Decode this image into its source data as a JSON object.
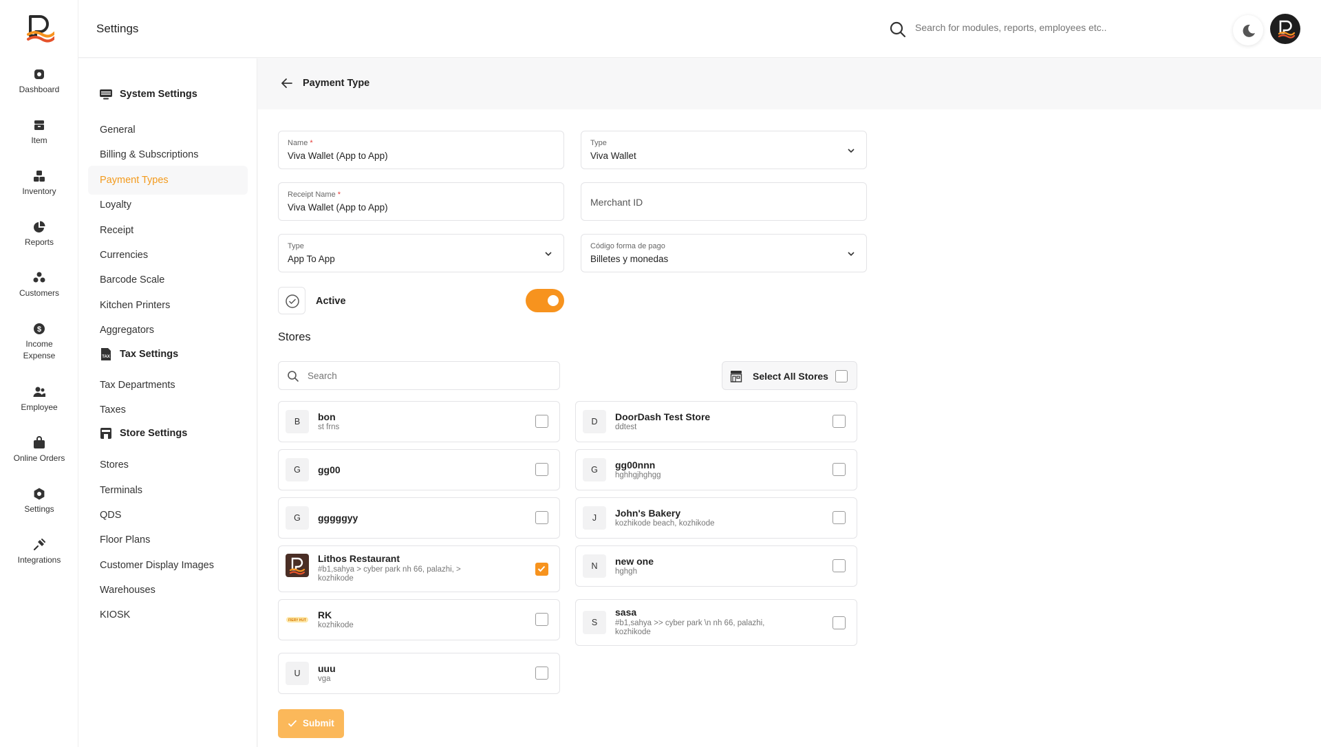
{
  "app": {
    "page_title": "Settings",
    "search_placeholder": "Search for modules, reports, employees etc.."
  },
  "rail": {
    "items": [
      {
        "label": "Dashboard",
        "icon": "dashboard-icon"
      },
      {
        "label": "Item",
        "icon": "item-icon"
      },
      {
        "label": "Inventory",
        "icon": "inventory-icon"
      },
      {
        "label": "Reports",
        "icon": "reports-icon"
      },
      {
        "label": "Customers",
        "icon": "customers-icon"
      },
      {
        "label": "Income Expense",
        "icon": "income-expense-icon"
      },
      {
        "label": "Employee",
        "icon": "employee-icon"
      },
      {
        "label": "Online Orders",
        "icon": "online-orders-icon"
      },
      {
        "label": "Settings",
        "icon": "settings-icon"
      },
      {
        "label": "Integrations",
        "icon": "integrations-icon"
      }
    ]
  },
  "menu": {
    "system_settings": "System Settings",
    "tax_settings": "Tax Settings",
    "store_settings": "Store Settings",
    "system_items": [
      "General",
      "Billing & Subscriptions",
      "Payment Types",
      "Loyalty",
      "Receipt",
      "Currencies",
      "Barcode Scale",
      "Kitchen Printers",
      "Aggregators"
    ],
    "tax_items": [
      "Tax Departments",
      "Taxes"
    ],
    "store_items": [
      "Stores",
      "Terminals",
      "QDS",
      "Floor Plans",
      "Customer Display Images",
      "Warehouses",
      "KIOSK"
    ],
    "active_item": "Payment Types"
  },
  "form": {
    "heading": "Payment Type",
    "name": {
      "label": "Name",
      "value": "Viva Wallet (App to App)"
    },
    "type_top": {
      "label": "Type",
      "value": "Viva Wallet"
    },
    "receipt_name": {
      "label": "Receipt Name",
      "value": "Viva Wallet (App to App)"
    },
    "merchant_id": {
      "placeholder": "Merchant ID"
    },
    "type_bottom": {
      "label": "Type",
      "value": "App To App"
    },
    "codigo": {
      "label": "Código forma de pago",
      "value": "Billetes y monedas"
    },
    "active": {
      "label": "Active",
      "on": true
    },
    "required_mark": "*"
  },
  "stores": {
    "title": "Stores",
    "search_placeholder": "Search",
    "select_all_label": "Select All Stores",
    "left": [
      {
        "initial": "B",
        "name": "bon",
        "sub": "st frns",
        "checked": false
      },
      {
        "initial": "G",
        "name": "gg00",
        "sub": "",
        "checked": false
      },
      {
        "initial": "G",
        "name": "gggggyy",
        "sub": "",
        "checked": false
      },
      {
        "initial": "",
        "name": "Lithos Restaurant",
        "sub": "#b1,sahya > cyber park nh 66, palazhi, > kozhikode",
        "checked": true
      },
      {
        "initial": "",
        "name": "RK",
        "sub": "kozhikode",
        "checked": false
      },
      {
        "initial": "U",
        "name": "uuu",
        "sub": "vga",
        "checked": false
      }
    ],
    "right": [
      {
        "initial": "D",
        "name": "DoorDash Test Store",
        "sub": "ddtest",
        "checked": false
      },
      {
        "initial": "G",
        "name": "gg00nnn",
        "sub": "hghhgjhghgg",
        "checked": false
      },
      {
        "initial": "J",
        "name": "John's Bakery",
        "sub": "kozhikode beach, kozhikode",
        "checked": false
      },
      {
        "initial": "N",
        "name": "new one",
        "sub": "hghgh",
        "checked": false
      },
      {
        "initial": "S",
        "name": "sasa",
        "sub": "#b1,sahya >> cyber park \\n nh 66, palazhi, kozhikode",
        "checked": false
      }
    ],
    "rk_logo_text": "FIERY HUT"
  },
  "submit_label": "Submit",
  "colors": {
    "accent": "#f7931e",
    "submit_bg": "#fbb85a"
  }
}
